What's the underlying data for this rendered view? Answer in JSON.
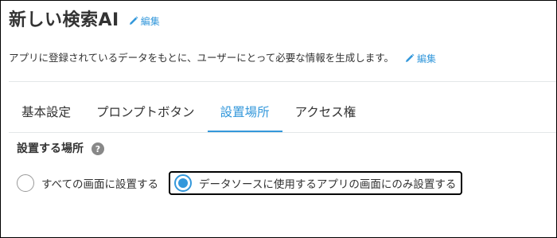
{
  "app": {
    "title": "新しい検索AI",
    "title_edit_label": "編集",
    "description": "アプリに登録されているデータをもとに、ユーザーにとって必要な情報を生成します。",
    "description_edit_label": "編集"
  },
  "tabs": [
    {
      "label": "基本設定",
      "active": false
    },
    {
      "label": "プロンプトボタン",
      "active": false
    },
    {
      "label": "設置場所",
      "active": true
    },
    {
      "label": "アクセス権",
      "active": false
    }
  ],
  "placement": {
    "heading": "設置する場所",
    "help_icon_glyph": "?",
    "options": [
      {
        "label": "すべての画面に設置する",
        "checked": false
      },
      {
        "label": "データソースに使用するアプリの画面にのみ設置する",
        "checked": true
      }
    ]
  },
  "colors": {
    "accent": "#3498db",
    "text": "#333333",
    "help_icon": "#888888",
    "focus_outline": "#000000"
  },
  "icons": {
    "edit": "pencil-icon",
    "help": "question-circle-icon",
    "radio_checked": "radio-checked-icon",
    "radio_unchecked": "radio-unchecked-icon"
  }
}
